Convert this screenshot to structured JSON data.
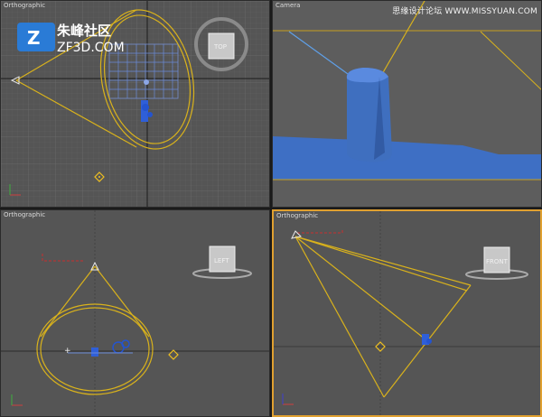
{
  "viewports": {
    "top": {
      "label": "Orthographic",
      "viewcube_face": "TOP"
    },
    "camera": {
      "label": "Camera"
    },
    "left": {
      "label": "Orthographic",
      "viewcube_face": "LEFT"
    },
    "front": {
      "label": "Orthographic",
      "viewcube_face": "FRONT"
    }
  },
  "logo": {
    "cn": "朱峰社区",
    "en": "ZF3D.COM"
  },
  "watermark": "思缘设计论坛 WWW.MISSYUAN.COM",
  "colors": {
    "viewport_bg": "#555555",
    "grid": "#626262",
    "light_cone": "#d9b21c",
    "active_border": "#e0a030",
    "cylinder": "#3f6fbf"
  }
}
